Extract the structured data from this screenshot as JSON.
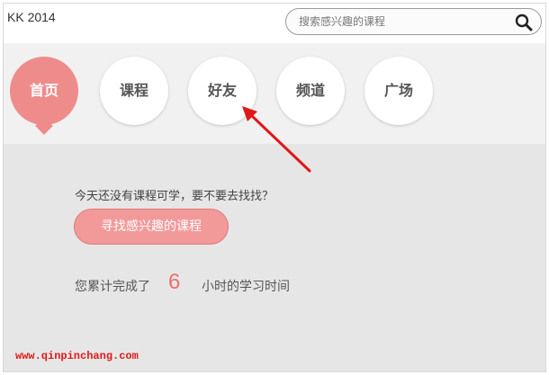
{
  "app": {
    "title": "KK 2014"
  },
  "search": {
    "placeholder": "搜索感兴趣的课程",
    "icon": "search-icon"
  },
  "nav": {
    "items": [
      {
        "label": "首页",
        "active": true
      },
      {
        "label": "课程",
        "active": false
      },
      {
        "label": "好友",
        "active": false
      },
      {
        "label": "频道",
        "active": false
      },
      {
        "label": "广场",
        "active": false
      }
    ]
  },
  "main": {
    "prompt": "今天还没有课程可学，要不要去找找？",
    "find_button": "寻找感兴趣的课程",
    "stats_prefix": "您累计完成了",
    "hours": "6",
    "stats_suffix": "小时的学习时间"
  },
  "watermark": "www.qinpinchang.com",
  "colors": {
    "accent": "#ee8c8c",
    "hours": "#ee6d6d",
    "annotation": "#e01818"
  }
}
